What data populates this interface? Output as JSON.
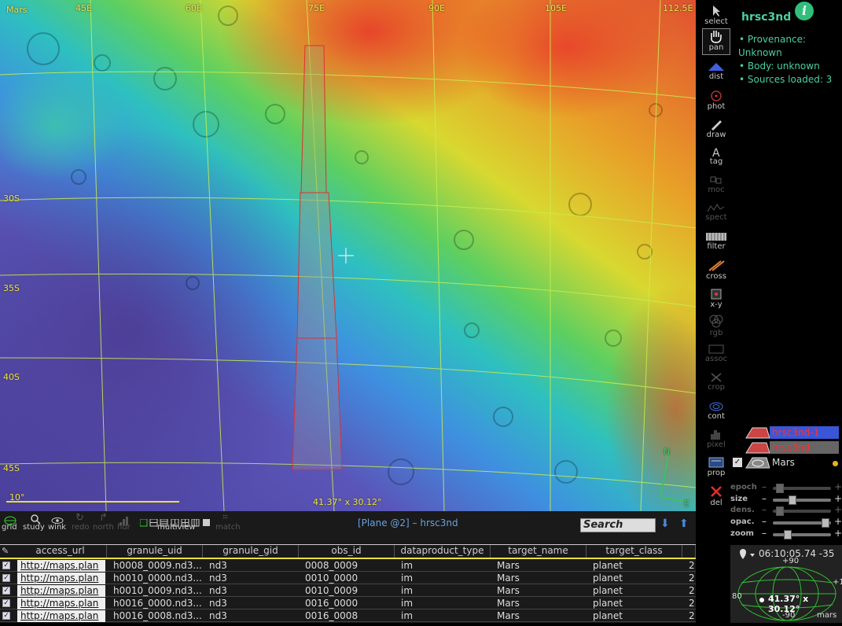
{
  "map": {
    "label": "Mars",
    "lon_labels": [
      "45E",
      "60E",
      "75E",
      "90E",
      "105E",
      "112.5E"
    ],
    "lat_labels": [
      "30S",
      "35S",
      "40S",
      "45S"
    ],
    "scale_label": "10°",
    "coord_readout": "41.37° x 30.12°",
    "compass_n": "N",
    "compass_e": "E"
  },
  "tools": [
    {
      "label": "select",
      "icon": "cursor-arrow-icon"
    },
    {
      "label": "pan",
      "icon": "hand-icon"
    },
    {
      "label": "dist",
      "icon": "distance-icon"
    },
    {
      "label": "phot",
      "icon": "photometry-icon"
    },
    {
      "label": "draw",
      "icon": "pencil-icon"
    },
    {
      "label": "tag",
      "icon": "tag-icon"
    },
    {
      "label": "moc",
      "icon": "moc-icon"
    },
    {
      "label": "spect",
      "icon": "spectrum-icon"
    },
    {
      "label": "filter",
      "icon": "filter-icon"
    },
    {
      "label": "cross",
      "icon": "crossmatch-icon"
    },
    {
      "label": "x-y",
      "icon": "xy-plot-icon"
    },
    {
      "label": "rgb",
      "icon": "rgb-icon"
    },
    {
      "label": "assoc",
      "icon": "assoc-icon"
    },
    {
      "label": "crop",
      "icon": "scissors-icon"
    },
    {
      "label": "cont",
      "icon": "contour-icon"
    },
    {
      "label": "pixel",
      "icon": "pixel-histogram-icon"
    },
    {
      "label": "prop",
      "icon": "properties-icon"
    },
    {
      "label": "del",
      "icon": "delete-x-icon"
    }
  ],
  "info": {
    "title": "hrsc3nd",
    "info_button": "i",
    "provenance": "• Provenance:",
    "provenance_value": "Unknown",
    "body": "• Body: unknown",
    "sources": "• Sources loaded: 3"
  },
  "planes": [
    {
      "name": "hrsc3nd-1",
      "color": "#3a56d8",
      "text_color": "#ff3030"
    },
    {
      "name": "hrsc3nd",
      "color": "#666666",
      "text_color": "#ff3030"
    },
    {
      "name": "Mars",
      "color": "#000000",
      "text_color": "#dddddd"
    }
  ],
  "sliders": [
    {
      "label": "epoch",
      "value": 0.1,
      "enabled": false
    },
    {
      "label": "size",
      "value": 0.3,
      "enabled": true
    },
    {
      "label": "dens.",
      "value": 0.1,
      "enabled": false
    },
    {
      "label": "opac.",
      "value": 0.95,
      "enabled": true
    },
    {
      "label": "zoom",
      "value": 0.2,
      "enabled": true
    }
  ],
  "minimap": {
    "coord": "06:10:05.74 -35",
    "top": "+90",
    "left": "80",
    "right": "+1",
    "bottom": "-90",
    "readout": "41.37° x 30.12°",
    "label": "mars"
  },
  "bottom_tools": {
    "grid": "grid",
    "study": "study",
    "wink": "wink",
    "redo": "redo",
    "north": "north",
    "hdr": "hdr",
    "multiview": "multiview",
    "match": "match"
  },
  "plane_title": "[Plane @2] – hrsc3nd",
  "search_placeholder": "Search",
  "table": {
    "columns": [
      "access_url",
      "granule_uid",
      "granule_gid",
      "obs_id",
      "dataproduct_type",
      "target_name",
      "target_class",
      ""
    ],
    "rows": [
      [
        "http://maps.plan",
        "h0008_0009.nd3...",
        "nd3",
        "0008_0009",
        "im",
        "Mars",
        "planet",
        "2"
      ],
      [
        "http://maps.plan",
        "h0010_0000.nd3...",
        "nd3",
        "0010_0000",
        "im",
        "Mars",
        "planet",
        "2"
      ],
      [
        "http://maps.plan",
        "h0010_0009.nd3...",
        "nd3",
        "0010_0009",
        "im",
        "Mars",
        "planet",
        "2"
      ],
      [
        "http://maps.plan",
        "h0016_0000.nd3...",
        "nd3",
        "0016_0000",
        "im",
        "Mars",
        "planet",
        "2"
      ],
      [
        "http://maps.plan",
        "h0016_0008.nd3...",
        "nd3",
        "0016_0008",
        "im",
        "Mars",
        "planet",
        "2"
      ]
    ]
  }
}
